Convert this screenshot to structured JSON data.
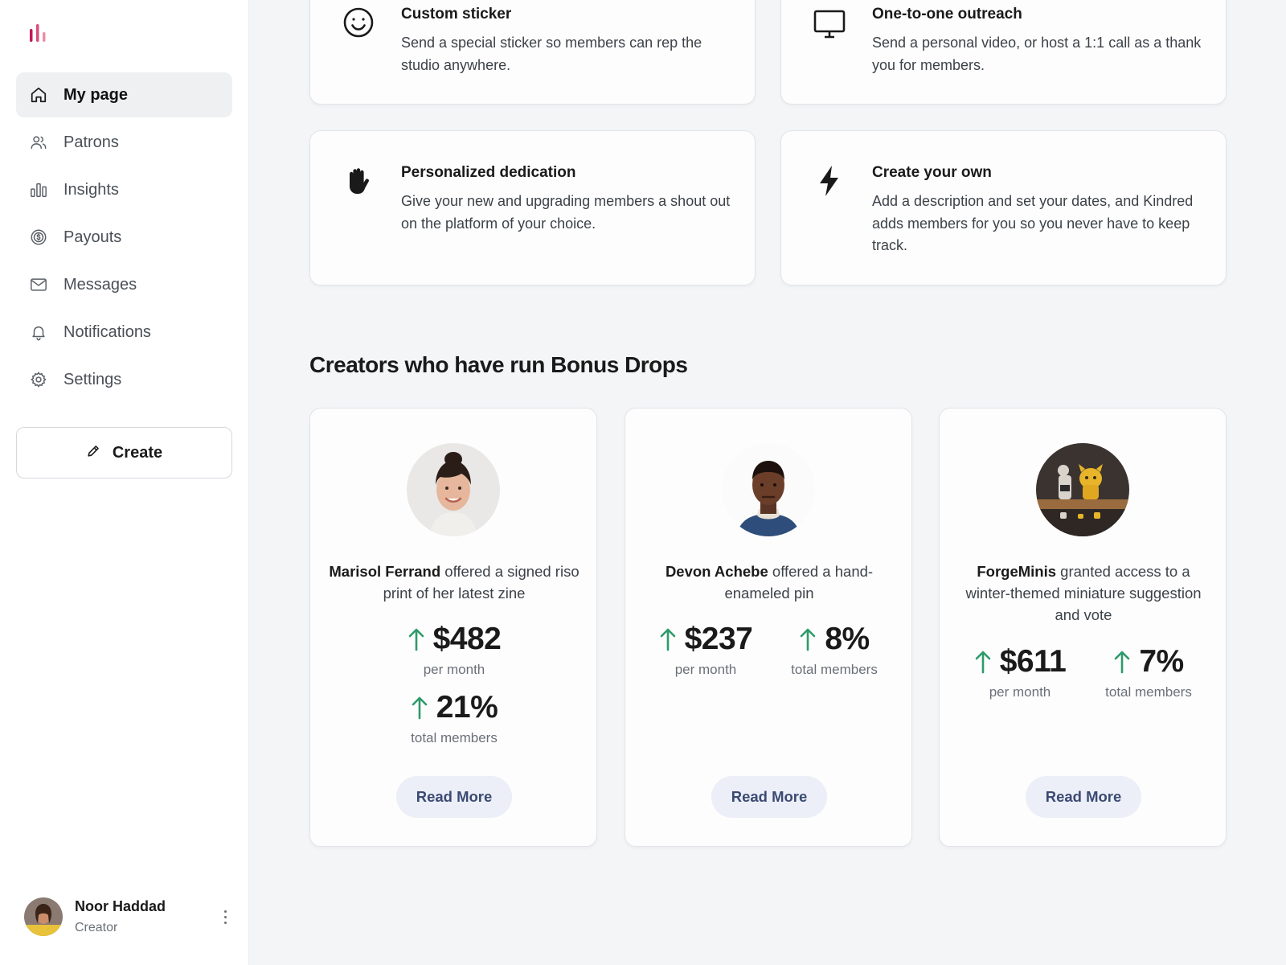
{
  "sidebar": {
    "nav": [
      {
        "label": "My page",
        "icon": "home-icon",
        "active": true
      },
      {
        "label": "Patrons",
        "icon": "users-icon"
      },
      {
        "label": "Insights",
        "icon": "bar-chart-icon"
      },
      {
        "label": "Payouts",
        "icon": "dollar-circle-icon"
      },
      {
        "label": "Messages",
        "icon": "mail-icon"
      },
      {
        "label": "Notifications",
        "icon": "bell-icon"
      },
      {
        "label": "Settings",
        "icon": "gear-icon"
      }
    ],
    "create_label": "Create",
    "user": {
      "name": "Noor Haddad",
      "role": "Creator"
    }
  },
  "perks": [
    {
      "icon": "smiley-icon",
      "title": "Custom sticker",
      "desc": "Send a special sticker so members can rep the studio anywhere."
    },
    {
      "icon": "monitor-icon",
      "title": "One-to-one outreach",
      "desc": "Send a personal video, or host a 1:1 call as a thank you for members."
    },
    {
      "icon": "hand-icon",
      "title": "Personalized dedication",
      "desc": "Give your new and upgrading members a shout out on the platform of your choice."
    },
    {
      "icon": "lightning-icon",
      "title": "Create your own",
      "desc": "Add a description and set your dates, and Kindred adds members for you so you never have to keep track."
    }
  ],
  "section_title": "Creators who have run Bonus Drops",
  "creators": [
    {
      "name": "Marisol Ferrand",
      "text": " offered a signed riso print of her latest zine",
      "stats": [
        {
          "value": "$482",
          "label": "per month"
        },
        {
          "value": "21%",
          "label": "total members"
        }
      ],
      "button": "Read More"
    },
    {
      "name": "Devon Achebe",
      "text": " offered a hand-enameled pin",
      "stats": [
        {
          "value": "$237",
          "label": "per month"
        },
        {
          "value": "8%",
          "label": "total members"
        }
      ],
      "button": "Read More"
    },
    {
      "name": "ForgeMinis",
      "text": " granted access to a winter-themed miniature suggestion and vote",
      "stats": [
        {
          "value": "$611",
          "label": "per month"
        },
        {
          "value": "7%",
          "label": "total members"
        }
      ],
      "button": "Read More"
    }
  ],
  "colors": {
    "accent_up": "#2e9a6a",
    "logo": "#c2185b",
    "button_bg": "#eceff7",
    "button_text": "#3b4a72"
  }
}
